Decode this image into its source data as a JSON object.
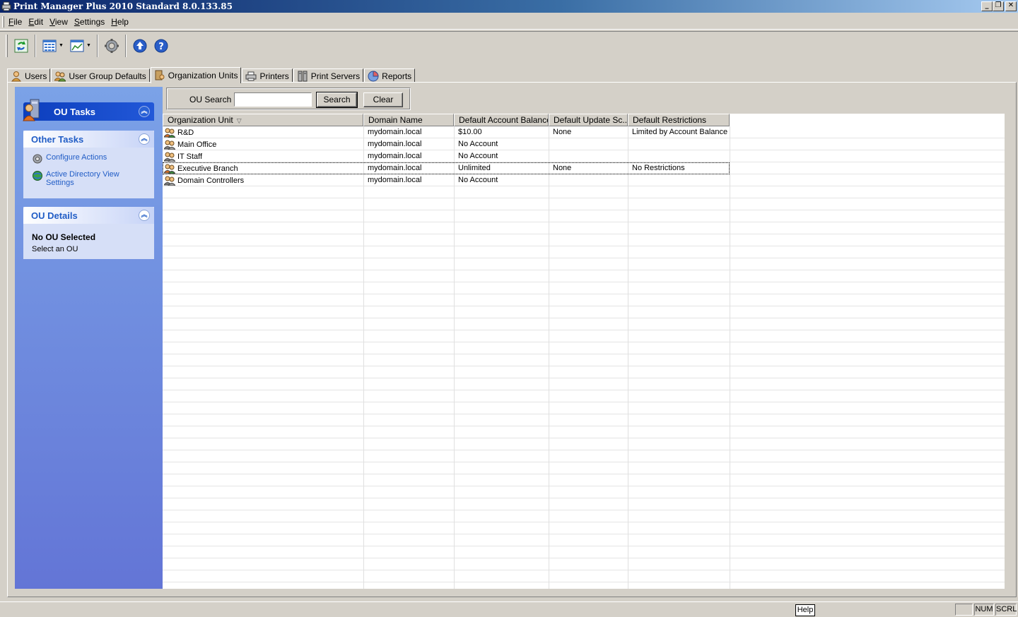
{
  "window": {
    "title": "Print Manager Plus 2010 Standard 8.0.133.85",
    "controls": {
      "minimize": "_",
      "restore": "❐",
      "close": "✕"
    }
  },
  "menu": {
    "items": [
      {
        "label": "File",
        "accel": "F",
        "rest": "ile"
      },
      {
        "label": "Edit",
        "accel": "E",
        "rest": "dit"
      },
      {
        "label": "View",
        "accel": "V",
        "rest": "iew"
      },
      {
        "label": "Settings",
        "accel": "S",
        "rest": "ettings"
      },
      {
        "label": "Help",
        "accel": "H",
        "rest": "elp"
      }
    ]
  },
  "toolbar": {
    "icons": [
      "refresh-icon",
      "view-grid-icon",
      "chart-view-icon",
      "settings-gear-icon",
      "upgrade-icon",
      "help-icon"
    ]
  },
  "tabs": [
    {
      "label": "Users",
      "icon": "user-icon"
    },
    {
      "label": "User Group Defaults",
      "icon": "user-group-icon"
    },
    {
      "label": "Organization Units",
      "icon": "org-unit-icon",
      "active": true
    },
    {
      "label": "Printers",
      "icon": "printer-icon"
    },
    {
      "label": "Print Servers",
      "icon": "server-icon"
    },
    {
      "label": "Reports",
      "icon": "reports-icon"
    }
  ],
  "taskpane": {
    "ou_tasks": {
      "title": "OU Tasks"
    },
    "other_tasks": {
      "title": "Other Tasks",
      "items": [
        {
          "label": "Configure Actions",
          "icon": "gear-icon"
        },
        {
          "label": "Active Directory View Settings",
          "icon": "globe-icon"
        }
      ]
    },
    "ou_details": {
      "title": "OU Details",
      "status": "No OU Selected",
      "hint": "Select an OU"
    }
  },
  "search": {
    "label": "OU Search",
    "value": "",
    "search_button": "Search",
    "clear_button": "Clear"
  },
  "grid": {
    "columns": [
      "Organization Unit",
      "Domain Name",
      "Default Account Balance",
      "Default Update Sc...",
      "Default Restrictions"
    ],
    "rows": [
      {
        "ou": "R&D",
        "domain": "mydomain.local",
        "balance": "$10.00",
        "update": "None",
        "restrictions": "Limited by Account Balance",
        "icon": "ou-active-icon"
      },
      {
        "ou": "Main Office",
        "domain": "mydomain.local",
        "balance": "No Account",
        "update": "",
        "restrictions": "",
        "icon": "ou-icon"
      },
      {
        "ou": "IT Staff",
        "domain": "mydomain.local",
        "balance": "No Account",
        "update": "",
        "restrictions": "",
        "icon": "ou-icon"
      },
      {
        "ou": "Executive Branch",
        "domain": "mydomain.local",
        "balance": "Unlimited",
        "update": "None",
        "restrictions": "No Restrictions",
        "icon": "ou-active-icon",
        "selected": true
      },
      {
        "ou": "Domain Controllers",
        "domain": "mydomain.local",
        "balance": "No Account",
        "update": "",
        "restrictions": "",
        "icon": "ou-icon"
      }
    ]
  },
  "statusbar": {
    "help_tip": "Help",
    "num": "NUM",
    "scrl": "SCRL"
  },
  "colors": {
    "taskpane_top": "#7ba2e7",
    "taskpane_bottom": "#6375d6",
    "link": "#215dc6",
    "window_face": "#d4d0c8"
  }
}
